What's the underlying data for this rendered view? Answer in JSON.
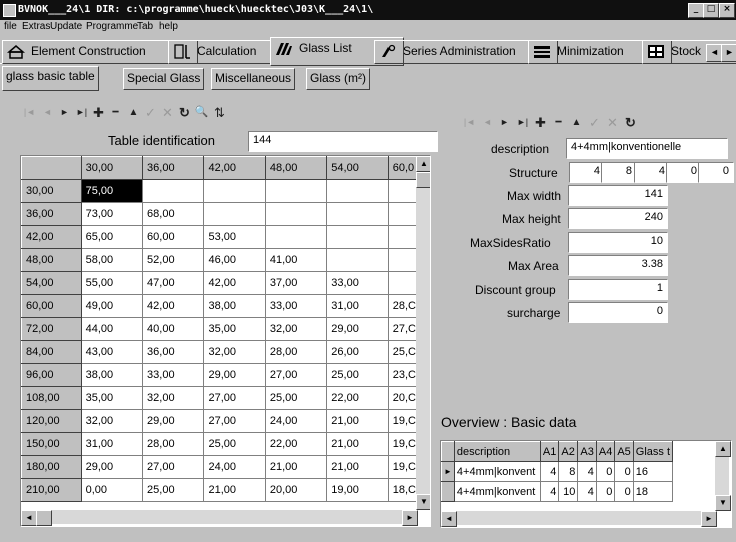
{
  "window": {
    "title": "BVNOK___24\\1 DIR: c:\\programme\\hueck\\huecktec\\J03\\K___24\\1\\",
    "min": "_",
    "max": "□",
    "close": "×"
  },
  "menu": [
    "file",
    "Extras",
    "Update",
    "Programme",
    "Tab",
    "help"
  ],
  "top_tabs": [
    {
      "label": "Element Construction",
      "icon": "element-construction-icon"
    },
    {
      "label": "Calculation",
      "icon": "calculation-icon"
    },
    {
      "label": "Glass List",
      "icon": "glass-list-icon",
      "active": true
    },
    {
      "label": "Series Administration",
      "icon": "series-administration-icon"
    },
    {
      "label": "Minimization",
      "icon": "minimization-icon"
    },
    {
      "label": "Stock",
      "icon": "stock-icon"
    }
  ],
  "tab_nav": {
    "left": "◄",
    "right": "►"
  },
  "sub_tabs": [
    {
      "label": "glass basic table",
      "active": true
    },
    {
      "label": "Special Glass"
    },
    {
      "label": "Miscellaneous"
    },
    {
      "label": "Glass (m²)"
    }
  ],
  "left_toolbar": {
    "first": "|◄",
    "prior": "◄",
    "next": "►",
    "last": "►|",
    "insert": "✚",
    "delete": "━",
    "edit": "▲",
    "post": "✓",
    "cancel": "✕",
    "refresh": "↻",
    "search": "🔍",
    "filter": "⇅"
  },
  "right_toolbar": {
    "first": "|◄",
    "prior": "◄",
    "next": "►",
    "last": "►|",
    "insert": "✚",
    "delete": "━",
    "edit": "▲",
    "post": "✓",
    "cancel": "✕",
    "refresh": "↻"
  },
  "table_identification": {
    "label": "Table identification",
    "value": "144"
  },
  "grid": {
    "col_headers": [
      "30,00",
      "36,00",
      "42,00",
      "48,00",
      "54,00",
      "60,0"
    ],
    "rows": [
      {
        "h": "30,00",
        "c": [
          "75,00",
          "",
          "",
          "",
          "",
          ""
        ]
      },
      {
        "h": "36,00",
        "c": [
          "73,00",
          "68,00",
          "",
          "",
          "",
          ""
        ]
      },
      {
        "h": "42,00",
        "c": [
          "65,00",
          "60,00",
          "53,00",
          "",
          "",
          ""
        ]
      },
      {
        "h": "48,00",
        "c": [
          "58,00",
          "52,00",
          "46,00",
          "41,00",
          "",
          ""
        ]
      },
      {
        "h": "54,00",
        "c": [
          "55,00",
          "47,00",
          "42,00",
          "37,00",
          "33,00",
          ""
        ]
      },
      {
        "h": "60,00",
        "c": [
          "49,00",
          "42,00",
          "38,00",
          "33,00",
          "31,00",
          "28,C"
        ]
      },
      {
        "h": "72,00",
        "c": [
          "44,00",
          "40,00",
          "35,00",
          "32,00",
          "29,00",
          "27,C"
        ]
      },
      {
        "h": "84,00",
        "c": [
          "43,00",
          "36,00",
          "32,00",
          "28,00",
          "26,00",
          "25,C"
        ]
      },
      {
        "h": "96,00",
        "c": [
          "38,00",
          "33,00",
          "29,00",
          "27,00",
          "25,00",
          "23,C"
        ]
      },
      {
        "h": "108,00",
        "c": [
          "35,00",
          "32,00",
          "27,00",
          "25,00",
          "22,00",
          "20,C"
        ]
      },
      {
        "h": "120,00",
        "c": [
          "32,00",
          "29,00",
          "27,00",
          "24,00",
          "21,00",
          "19,C"
        ]
      },
      {
        "h": "150,00",
        "c": [
          "31,00",
          "28,00",
          "25,00",
          "22,00",
          "21,00",
          "19,C"
        ]
      },
      {
        "h": "180,00",
        "c": [
          "29,00",
          "27,00",
          "24,00",
          "21,00",
          "21,00",
          "19,C"
        ]
      },
      {
        "h": "210,00",
        "c": [
          "0,00",
          "25,00",
          "21,00",
          "20,00",
          "19,00",
          "18,C"
        ]
      }
    ]
  },
  "form": {
    "description": {
      "label": "description",
      "value": "4+4mm|konventionelle"
    },
    "structure": {
      "label": "Structure",
      "values": [
        "4",
        "8",
        "4",
        "0",
        "0"
      ]
    },
    "max_width": {
      "label": "Max width",
      "value": "141"
    },
    "max_height": {
      "label": "Max height",
      "value": "240"
    },
    "max_sides_ratio": {
      "label": "MaxSidesRatio",
      "value": "10"
    },
    "max_area": {
      "label": "Max Area",
      "value": "3.38"
    },
    "discount_group": {
      "label": "Discount group",
      "value": "1"
    },
    "surcharge": {
      "label": "surcharge",
      "value": "0"
    }
  },
  "overview": {
    "title": "Overview : Basic data",
    "headers": [
      "description",
      "A1",
      "A2",
      "A3",
      "A4",
      "A5",
      "Glass t"
    ],
    "rows": [
      [
        "4+4mm|konvent",
        "4",
        "8",
        "4",
        "0",
        "0",
        "16"
      ],
      [
        "4+4mm|konvent",
        "4",
        "10",
        "4",
        "0",
        "0",
        "18"
      ]
    ]
  }
}
